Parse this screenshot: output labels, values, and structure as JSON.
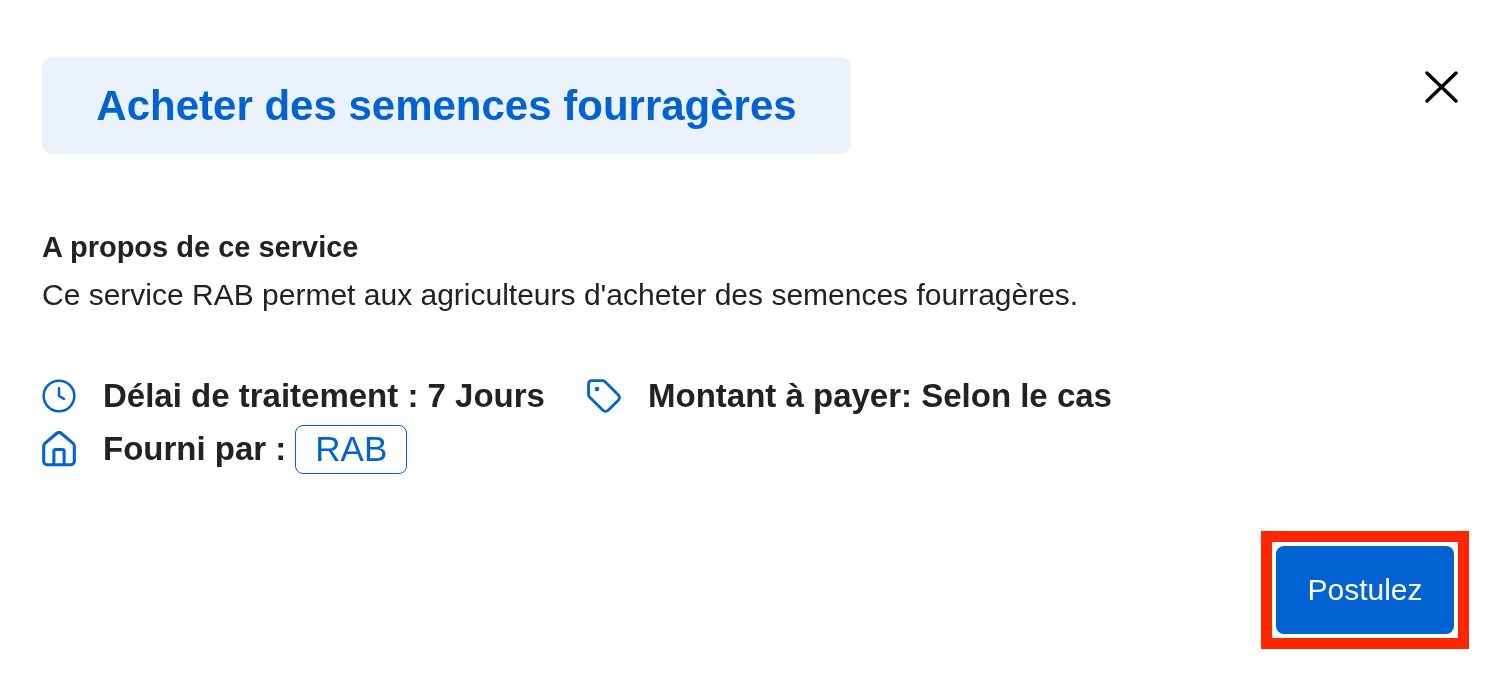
{
  "dialog": {
    "title": "Acheter des semences fourragères"
  },
  "about": {
    "heading": "A propos de ce service",
    "description": "Ce service RAB permet aux agriculteurs d'acheter des semences fourragères."
  },
  "detail_rows": [
    {
      "items": [
        {
          "kind": "time",
          "label": "Délai de traitement : 7 Jours"
        },
        {
          "kind": "cost",
          "label": "Montant à payer: Selon le cas"
        }
      ]
    },
    {
      "items": [
        {
          "kind": "provider",
          "label": "Fourni par :",
          "badge": "RAB"
        }
      ]
    }
  ],
  "actions": [
    {
      "label": "Postulez",
      "highlighted": true
    }
  ]
}
